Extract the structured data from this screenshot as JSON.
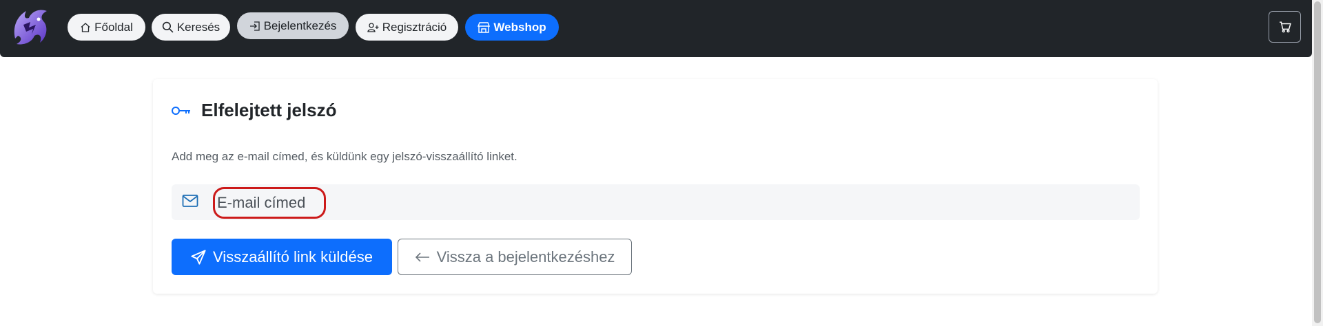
{
  "nav": {
    "items": [
      {
        "label": "Főoldal",
        "icon": "house-icon"
      },
      {
        "label": "Keresés",
        "icon": "search-icon"
      },
      {
        "label": "Bejelentkezés",
        "icon": "login-icon"
      },
      {
        "label": "Regisztráció",
        "icon": "person-plus-icon"
      },
      {
        "label": "Webshop",
        "icon": "shop-icon"
      }
    ],
    "cart_icon": "cart-icon",
    "accent": "#0d6efd",
    "bg": "#212529"
  },
  "card": {
    "title": "Elfelejtett jelszó",
    "title_icon": "key-icon",
    "description": "Add meg az e-mail címed, és küldünk egy jelszó-visszaállító linket.",
    "email": {
      "placeholder": "E-mail címed",
      "value": "",
      "icon": "envelope-icon"
    },
    "submit_label": "Visszaállító link küldése",
    "back_label": "Vissza a bejelentkezéshez"
  },
  "highlight_color": "#cc1a1a"
}
